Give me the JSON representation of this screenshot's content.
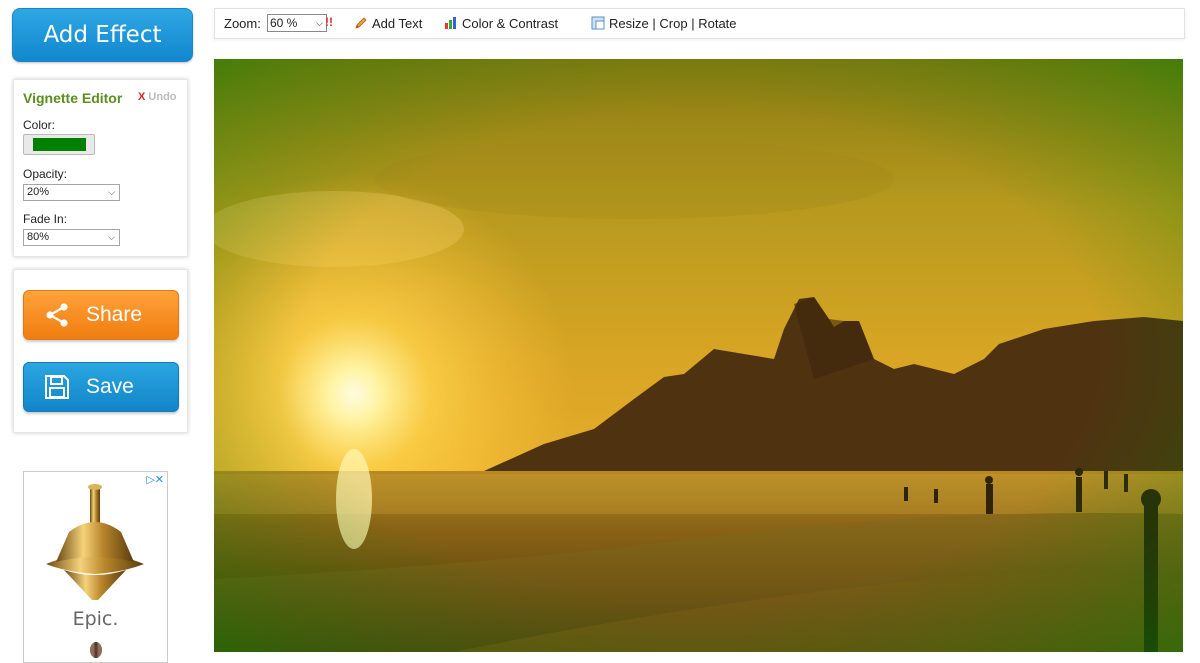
{
  "sidebar": {
    "add_effect_label": "Add Effect",
    "vignette": {
      "title": "Vignette Editor",
      "undo_x": "X",
      "undo_label": "Undo",
      "color_label": "Color:",
      "color_value": "#008000",
      "opacity_label": "Opacity:",
      "opacity_value": "20%",
      "fade_label": "Fade In:",
      "fade_value": "80%"
    },
    "share_label": "Share",
    "save_label": "Save",
    "ad": {
      "text": "Epic."
    }
  },
  "toolbar": {
    "zoom_label": "Zoom:",
    "zoom_value": "60 %",
    "zoom_warning": "!!",
    "add_text": "Add Text",
    "color_contrast": "Color & Contrast",
    "resize": "Resize",
    "sep1": "|",
    "crop": "Crop",
    "sep2": "|",
    "rotate": "Rotate"
  },
  "colors": {
    "accent_blue": "#1a96d8",
    "accent_orange": "#f58b1f",
    "vignette_green": "#008000",
    "title_green": "#5a8f1f"
  }
}
